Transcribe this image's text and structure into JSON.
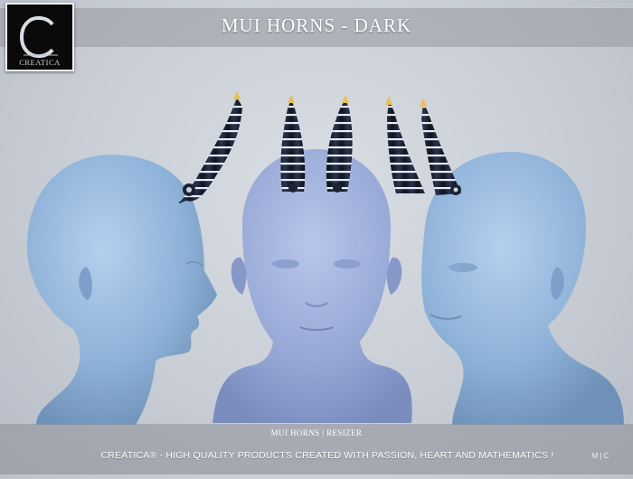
{
  "header": {
    "title": "MUI HORNS - DARK",
    "logo_text": "CREATICA",
    "logo_letter": "C"
  },
  "footer": {
    "product_line": "MUI  HORNS  |  RESIZER",
    "tagline": "CREATICA® - HIGH QUALITY PRODUCTS CREATED WITH PASSION, HEART AND MATHEMATICS !",
    "signature": "M|C"
  },
  "colors": {
    "head": "#8fb2d8",
    "horn": "#1b2334",
    "horn_band": "#e8edf2",
    "horn_tip": "#e6c15a"
  }
}
